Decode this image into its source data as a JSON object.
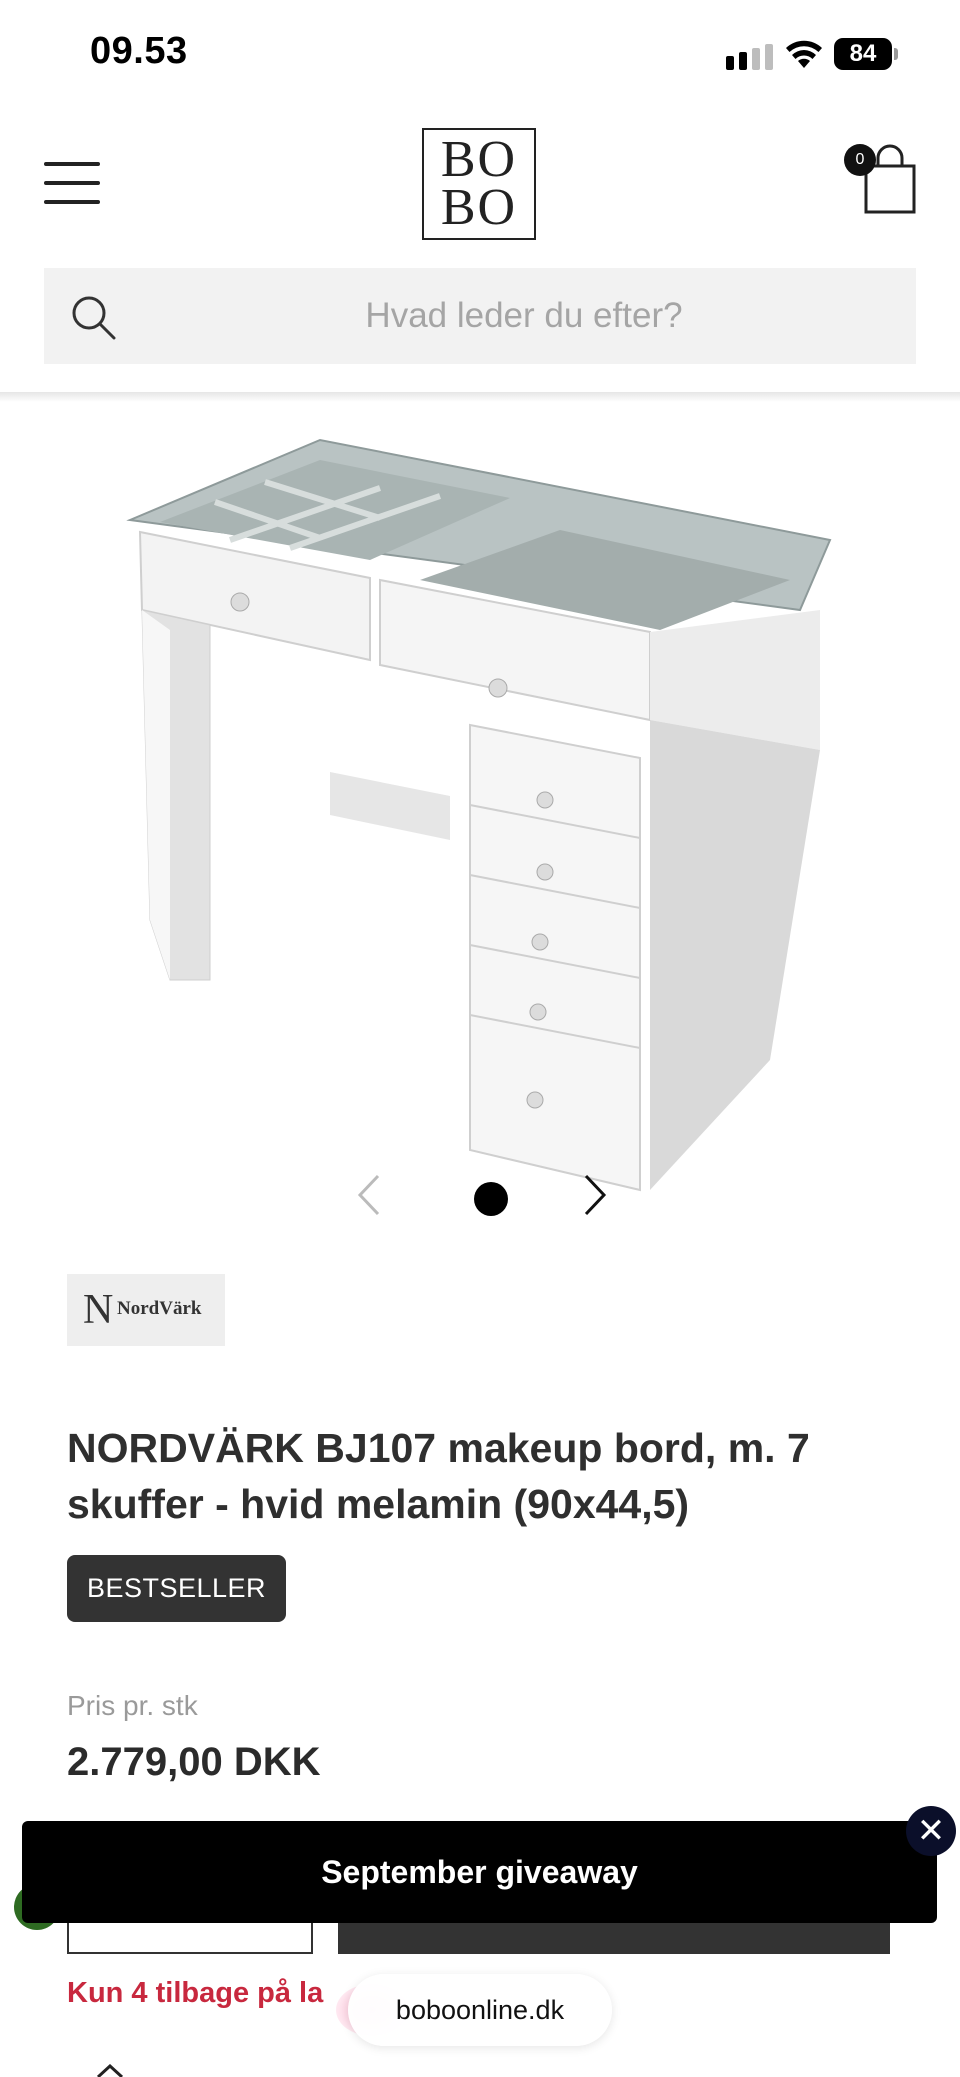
{
  "status_bar": {
    "time": "09.53",
    "battery": "84"
  },
  "header": {
    "logo_line1": "BO",
    "logo_line2": "BO",
    "cart_count": "0"
  },
  "search": {
    "placeholder": "Hvad leder du efter?"
  },
  "product": {
    "brand_initial": "N",
    "brand_name": "NordVärk",
    "title": "NORDVÄRK BJ107 makeup bord, m. 7 skuffer - hvid melamin (90x44,5)",
    "badge": "BESTSELLER",
    "price_label": "Pris pr. stk",
    "price": "2.779,00 DKK",
    "stock_text": "Kun 4 tilbage på la"
  },
  "carousel": {
    "current": 1,
    "total": 1
  },
  "banner": {
    "label": "September giveaway",
    "close": "✕"
  },
  "browser": {
    "url": "boboonline.dk"
  },
  "icons": [
    "signal-icon",
    "wifi-icon",
    "battery-icon",
    "menu-icon",
    "cart-icon",
    "search-icon",
    "chevron-left-icon",
    "chevron-right-icon",
    "close-icon"
  ]
}
